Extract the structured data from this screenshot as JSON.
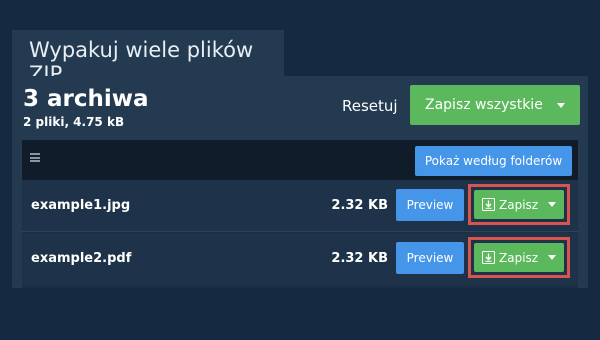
{
  "tab": {
    "title": "Wypakuj wiele plików ZIP"
  },
  "summary": {
    "archives": "3 archiwa",
    "details": "2 pliki, 4.75 kB"
  },
  "toolbar": {
    "reset_label": "Resetuj",
    "save_all_label": "Zapisz wszystkie"
  },
  "list": {
    "folders_button": "Pokaż według folderów",
    "files": [
      {
        "name": "example1.jpg",
        "size": "2.32 KB",
        "preview_label": "Preview",
        "save_label": "Zapisz"
      },
      {
        "name": "example2.pdf",
        "size": "2.32 KB",
        "preview_label": "Preview",
        "save_label": "Zapisz"
      }
    ]
  },
  "colors": {
    "background": "#152a40",
    "panel": "#233a50",
    "accent_green": "#5cb85c",
    "accent_blue": "#4596e8",
    "highlight_red": "#d9534f"
  },
  "icons": {
    "menu": "hamburger-icon",
    "download": "download-icon",
    "dropdown": "caret-down-icon"
  }
}
